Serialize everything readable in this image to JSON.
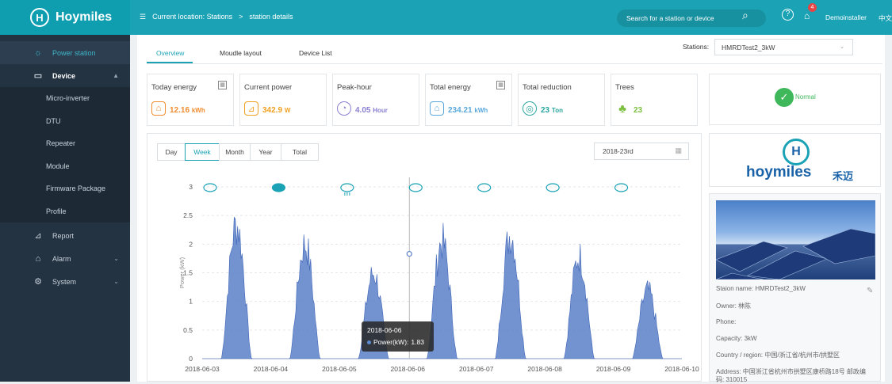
{
  "brand": {
    "name": "Hoymiles",
    "mark": "H"
  },
  "sidebar": {
    "items": [
      {
        "label": "Power station",
        "icon": "sun-icon"
      },
      {
        "label": "Device",
        "icon": "monitor-icon"
      },
      {
        "label": "Micro-inverter"
      },
      {
        "label": "DTU"
      },
      {
        "label": "Repeater"
      },
      {
        "label": "Module"
      },
      {
        "label": "Firmware Package"
      },
      {
        "label": "Profile"
      },
      {
        "label": "Report",
        "icon": "report-icon"
      },
      {
        "label": "Alarm",
        "icon": "alarm-icon"
      },
      {
        "label": "System",
        "icon": "gear-icon"
      }
    ]
  },
  "topbar": {
    "location_label": "Current location: Stations",
    "separator": ">",
    "location_page": "station details",
    "search_placeholder": "Search for a station or device",
    "notification_count": "4",
    "user": "Demoinstaller",
    "language": "中文"
  },
  "tabs": [
    {
      "label": "Overview"
    },
    {
      "label": "Moudle layout"
    },
    {
      "label": "Device List"
    }
  ],
  "station_select": {
    "label": "Stations:",
    "value": "HMRDTest2_3kW"
  },
  "cards": [
    {
      "title": "Today energy",
      "value": "12.16",
      "unit": "kWh",
      "color": "#f08c2e"
    },
    {
      "title": "Current power",
      "value": "342.9",
      "unit": "W",
      "color": "#f0a020"
    },
    {
      "title": "Peak-hour",
      "value": "4.05",
      "unit": "Hour",
      "color": "#8a7fd0"
    },
    {
      "title": "Total energy",
      "value": "234.21",
      "unit": "kWh",
      "color": "#5aa8dc"
    },
    {
      "title": "Total reduction",
      "value": "23",
      "unit": "Ton",
      "color": "#2aa6a0"
    },
    {
      "title": "Trees",
      "value": "23",
      "unit": "",
      "color": "#7bbf3e"
    }
  ],
  "status": {
    "label": "Normal"
  },
  "brand_card": {
    "name": "hoymiles",
    "cn": "禾迈"
  },
  "station_info": {
    "name": "Staion name: HMRDTest2_3kW",
    "owner": "Owner: 林陈",
    "phone": "Phone:",
    "capacity": "Capacity: 3kW",
    "region": "Country / region: 中国/浙江省/杭州市/拱墅区",
    "address": "Address: 中国浙江省杭州市拱墅区康桥路18号 邮政编",
    "address2": "码: 310015"
  },
  "period_buttons": [
    {
      "label": "Day"
    },
    {
      "label": "Week"
    },
    {
      "label": "Month"
    },
    {
      "label": "Year"
    },
    {
      "label": "Total"
    }
  ],
  "date_value": "2018-23rd",
  "tooltip": {
    "date": "2018-06-06",
    "series": "Power(kW):",
    "value": "1.83"
  },
  "chart_data": {
    "type": "area",
    "ylabel": "Power (kW)",
    "ylim": [
      0,
      3
    ],
    "yticks": [
      "0",
      "0.5",
      "1",
      "1.5",
      "2",
      "2.5",
      "3"
    ],
    "x": [
      "2018-06-03",
      "2018-06-04",
      "2018-06-05",
      "2018-06-06",
      "2018-06-07",
      "2018-06-08",
      "2018-06-09",
      "2018-06-10"
    ],
    "series": [
      {
        "name": "Power(kW)",
        "daily_peaks": [
          2.75,
          2.35,
          1.75,
          2.4,
          2.55,
          2.1,
          1.4
        ]
      }
    ],
    "weather": [
      "cloudy",
      "cloudy-night",
      "rain",
      "cloudy",
      "cloudy",
      "cloudy",
      "cloudy"
    ],
    "grid": true,
    "color": "#5b7fc8"
  }
}
